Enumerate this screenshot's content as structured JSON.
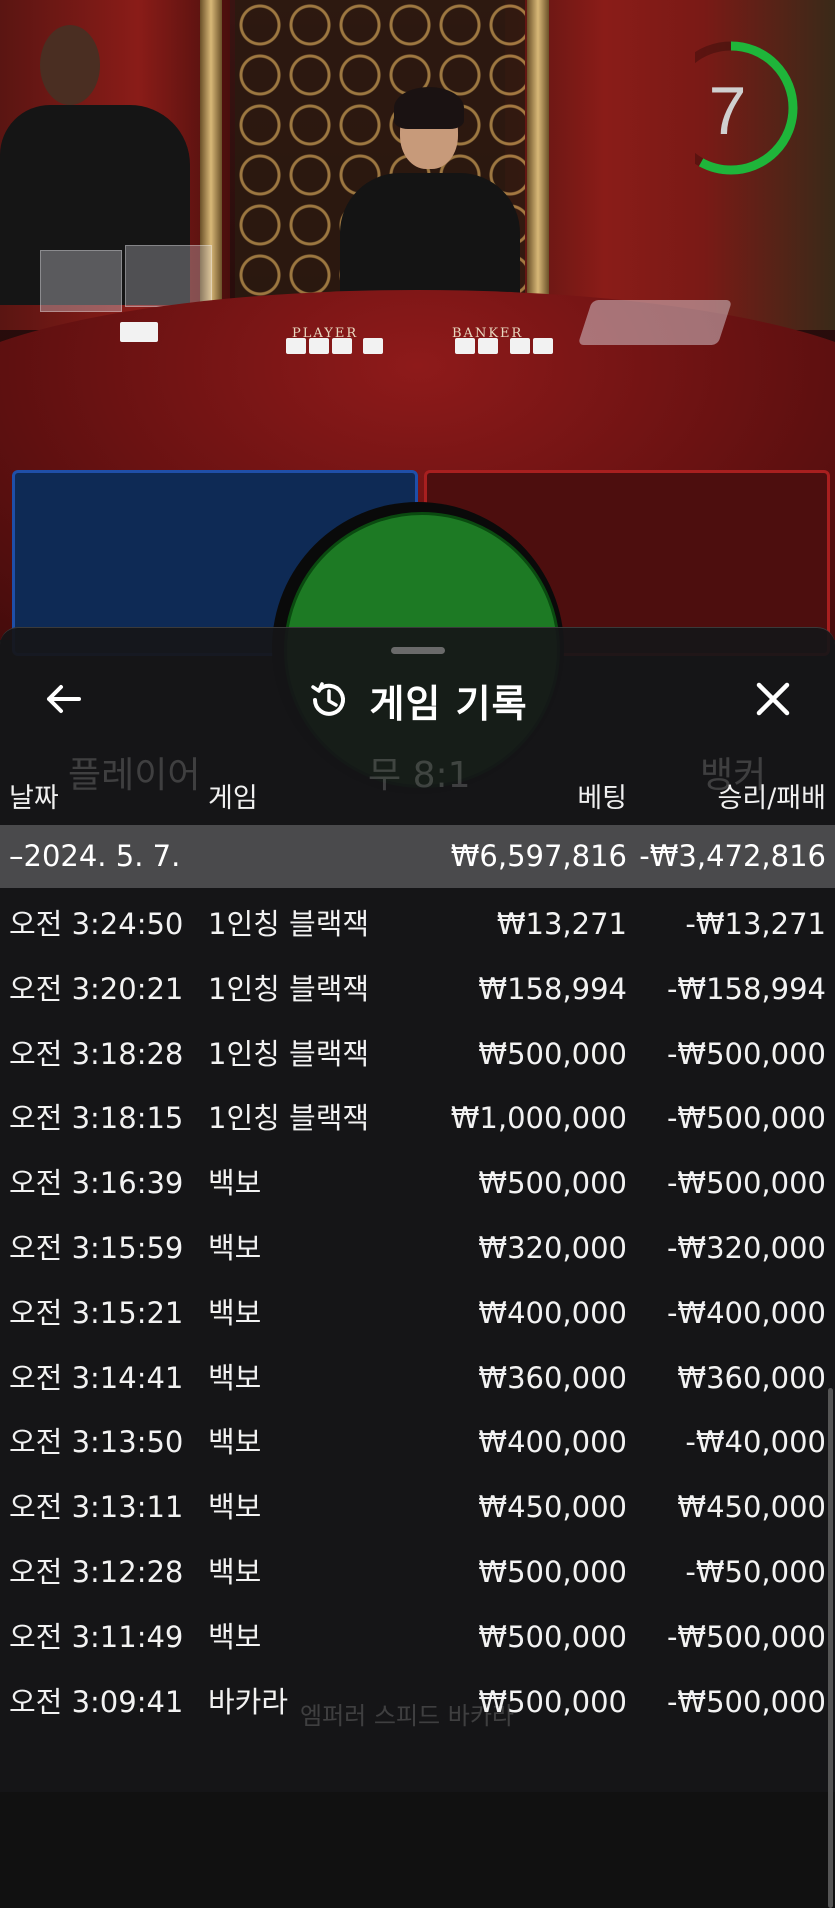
{
  "timer": {
    "count": "7",
    "progress": 0.58,
    "color": "#1fb53a"
  },
  "table": {
    "player_label": "PLAYER",
    "banker_label": "BANKER"
  },
  "colors": {
    "player": "#1f4fa8",
    "banker": "#a81f1f",
    "tie": "#1d7a24",
    "date_row": "#4a4a4c"
  },
  "sheet": {
    "title": "게임 기록",
    "back_icon": "arrow-left-icon",
    "close_icon": "close-icon",
    "history_icon": "history-clock-icon",
    "columns": {
      "date": "날짜",
      "game": "게임",
      "bet": "베팅",
      "result": "승리/패배"
    },
    "date_group": {
      "date": "–2024. 5. 7.",
      "bet_total": "₩6,597,816",
      "result_total": "-₩3,472,816"
    },
    "rows": [
      {
        "time": "오전 3:24:50",
        "game": "1인칭 블랙잭",
        "bet": "₩13,271",
        "result": "-₩13,271"
      },
      {
        "time": "오전 3:20:21",
        "game": "1인칭 블랙잭",
        "bet": "₩158,994",
        "result": "-₩158,994"
      },
      {
        "time": "오전 3:18:28",
        "game": "1인칭 블랙잭",
        "bet": "₩500,000",
        "result": "-₩500,000"
      },
      {
        "time": "오전 3:18:15",
        "game": "1인칭 블랙잭",
        "bet": "₩1,000,000",
        "result": "-₩500,000"
      },
      {
        "time": "오전 3:16:39",
        "game": "백보",
        "bet": "₩500,000",
        "result": "-₩500,000"
      },
      {
        "time": "오전 3:15:59",
        "game": "백보",
        "bet": "₩320,000",
        "result": "-₩320,000"
      },
      {
        "time": "오전 3:15:21",
        "game": "백보",
        "bet": "₩400,000",
        "result": "-₩400,000"
      },
      {
        "time": "오전 3:14:41",
        "game": "백보",
        "bet": "₩360,000",
        "result": "₩360,000"
      },
      {
        "time": "오전 3:13:50",
        "game": "백보",
        "bet": "₩400,000",
        "result": "-₩40,000"
      },
      {
        "time": "오전 3:13:11",
        "game": "백보",
        "bet": "₩450,000",
        "result": "₩450,000"
      },
      {
        "time": "오전 3:12:28",
        "game": "백보",
        "bet": "₩500,000",
        "result": "-₩50,000"
      },
      {
        "time": "오전 3:11:49",
        "game": "백보",
        "bet": "₩500,000",
        "result": "-₩500,000"
      },
      {
        "time": "오전 3:09:41",
        "game": "바카라",
        "bet": "₩500,000",
        "result": "-₩500,000"
      }
    ]
  },
  "background_ghost": {
    "player_label": "플레이어",
    "tie_label": "무 8:1",
    "banker_label": "뱅커",
    "footer_game": "엠퍼러 스피드 바카라"
  }
}
